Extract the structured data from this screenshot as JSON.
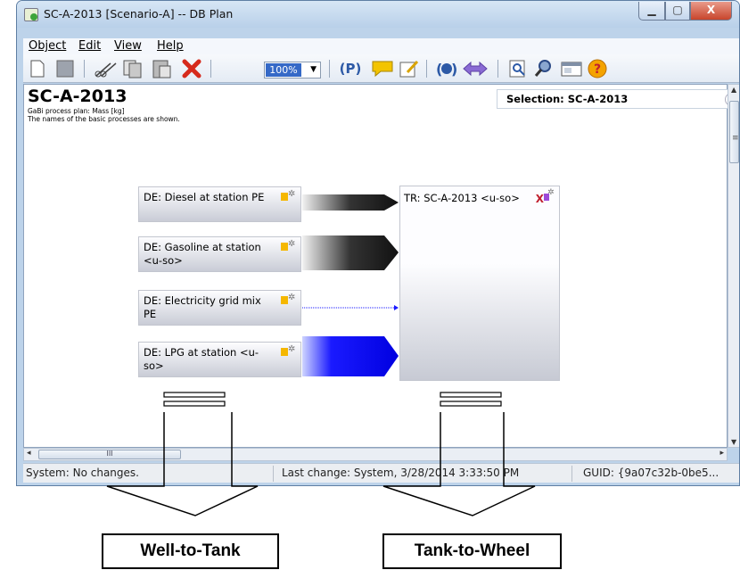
{
  "window": {
    "title": "SC-A-2013 [Scenario-A] -- DB Plan",
    "controls": {
      "minimize": "▁",
      "maximize": "▢",
      "close": "X"
    }
  },
  "menu": [
    {
      "label": "Object",
      "key": "O"
    },
    {
      "label": "Edit",
      "key": "E"
    },
    {
      "label": "View",
      "key": "V"
    },
    {
      "label": "Help",
      "key": "H"
    }
  ],
  "toolbar": {
    "zoom": "100%",
    "p_label": "(P)",
    "icons": [
      "new-document-icon",
      "save-icon",
      "cut-icon",
      "copy-icon",
      "paste-icon",
      "delete-icon",
      "zoom-select",
      "parameter-icon",
      "comment-icon",
      "edit-icon",
      "quantity-icon",
      "swap-icon",
      "zoom-fit-icon",
      "search-icon",
      "window-icon",
      "help-icon"
    ]
  },
  "plan": {
    "title": "SC-A-2013",
    "subtitle_1": "GaBi process plan: Mass [kg]",
    "subtitle_2": "The names of the basic processes are shown.",
    "selection": "Selection: SC-A-2013"
  },
  "processes": [
    {
      "name": "DE: Diesel at station PE"
    },
    {
      "name": "DE: Gasoline at station <u-so>"
    },
    {
      "name": "DE: Electricity grid mix PE"
    },
    {
      "name": "DE: LPG at station <u-so>"
    }
  ],
  "transport": {
    "name": "TR: SC-A-2013 <u-so>",
    "mark": "X"
  },
  "scroll": {
    "h_thumb": "III"
  },
  "status": {
    "left": "System: No changes.",
    "middle": "Last change: System, 3/28/2014 3:33:50 PM",
    "right": "GUID: {9a07c32b-0be5..."
  },
  "annotations": {
    "left": "Well-to-Tank",
    "right": "Tank-to-Wheel"
  },
  "colors": {
    "blue_flow": "#1a1aff",
    "dark_flow": "#111111",
    "title_bar": "#b9d0e9"
  }
}
